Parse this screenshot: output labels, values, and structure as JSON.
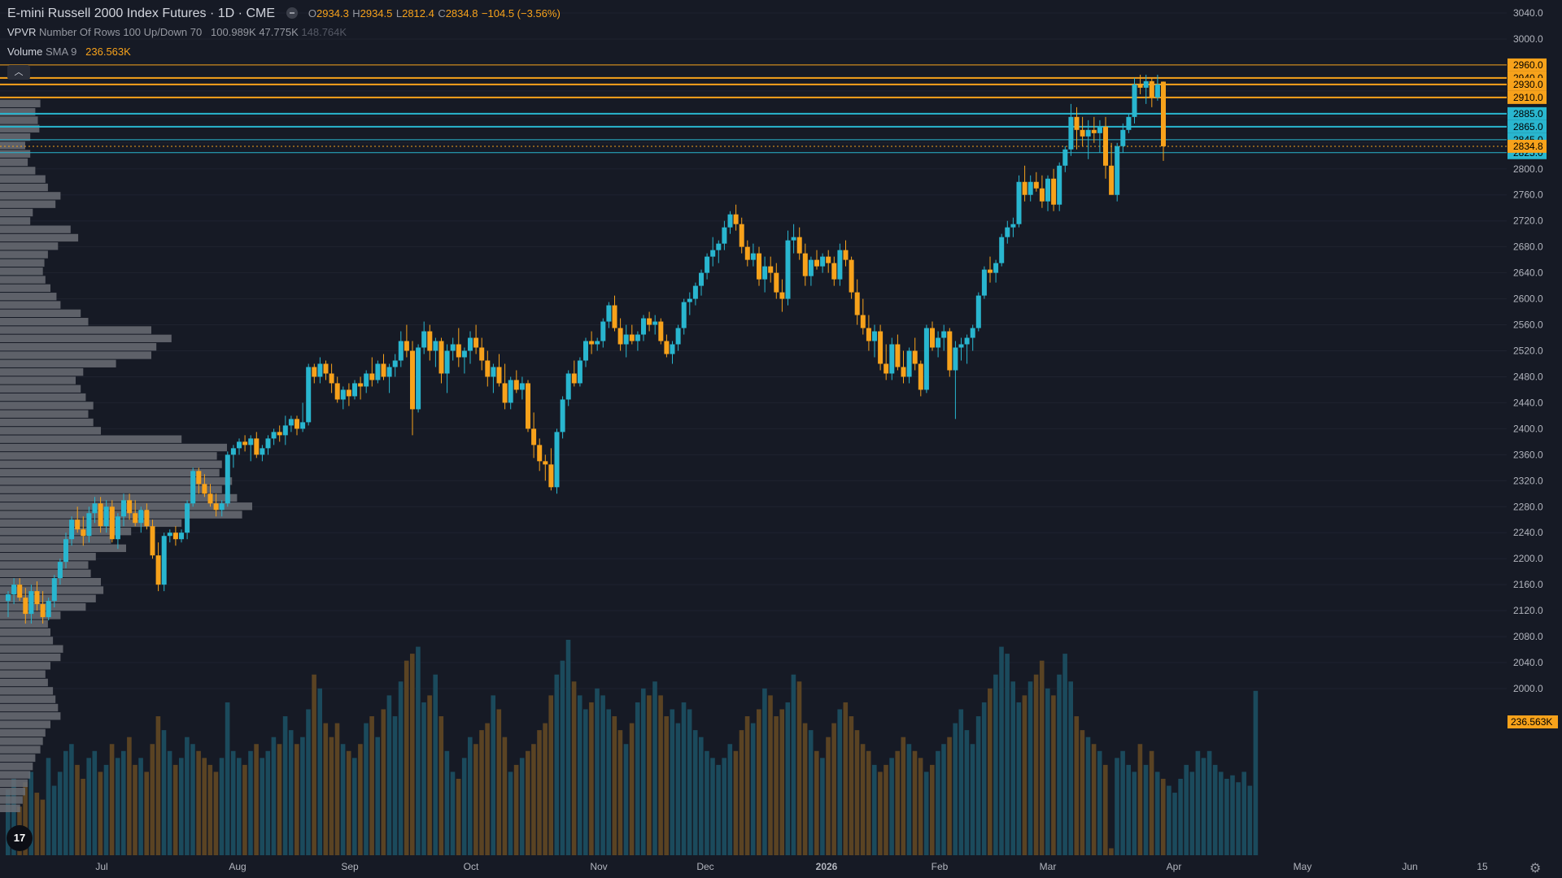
{
  "legend": {
    "symbol": "E-mini Russell 2000 Index Futures · 1D · CME",
    "open_label": "O",
    "open": "2934.3",
    "high_label": "H",
    "high": "2934.5",
    "low_label": "L",
    "low": "2812.4",
    "close_label": "C",
    "close": "2834.8",
    "change": "−104.5 (−3.56%)",
    "vpvr_name": "VPVR",
    "vpvr_params": "Number Of Rows 100 Up/Down 70",
    "vpvr_v1": "100.989K",
    "vpvr_v2": "47.775K",
    "vpvr_v3": "148.764K",
    "volume_name": "Volume",
    "volume_params": "SMA 9",
    "volume_value": "236.563K"
  },
  "colors": {
    "background": "#161a25",
    "up": "#29b6cf",
    "down": "#f7a21b",
    "volume_up": "#1b4a5c",
    "volume_down": "#5a4323",
    "profile": "#6b6e75",
    "grid": "#1f2330",
    "axis_text": "#b2b5be"
  },
  "price_axis": {
    "ticks": [
      "3040.0",
      "3000.0",
      "2800.0",
      "2760.0",
      "2720.0",
      "2680.0",
      "2640.0",
      "2600.0",
      "2560.0",
      "2520.0",
      "2480.0",
      "2440.0",
      "2400.0",
      "2360.0",
      "2320.0",
      "2280.0",
      "2240.0",
      "2200.0",
      "2160.0",
      "2120.0",
      "2080.0",
      "2040.0",
      "2000.0"
    ]
  },
  "level_labels": {
    "orange": [
      "2960.0",
      "2940.0",
      "2930.0",
      "2910.0"
    ],
    "blue": [
      "2885.0",
      "2865.0",
      "2845.0",
      "2825.0"
    ],
    "last_price": "2834.8",
    "volume_sma": "236.563K"
  },
  "time_axis": {
    "labels": [
      "Jul",
      "Aug",
      "Sep",
      "Oct",
      "Nov",
      "Dec",
      "2026",
      "Feb",
      "Mar",
      "Apr",
      "May",
      "Jun",
      "15"
    ]
  },
  "icons": {
    "tv_logo": "17",
    "gear": "⚙",
    "collapse": "︿"
  },
  "chart_data": {
    "type": "candlestick",
    "y_range": [
      1995,
      3050
    ],
    "horizontal_levels": {
      "orange": [
        2960.0,
        2940.0,
        2930.0,
        2910.0
      ],
      "blue": [
        2885.0,
        2865.0,
        2845.0,
        2825.0
      ],
      "last_price": 2834.8
    },
    "candles": [
      [
        2135,
        2150,
        2110,
        2145
      ],
      [
        2145,
        2170,
        2130,
        2160
      ],
      [
        2160,
        2170,
        2135,
        2140
      ],
      [
        2140,
        2155,
        2100,
        2115
      ],
      [
        2115,
        2160,
        2100,
        2150
      ],
      [
        2150,
        2165,
        2120,
        2130
      ],
      [
        2130,
        2150,
        2100,
        2110
      ],
      [
        2110,
        2140,
        2105,
        2135
      ],
      [
        2135,
        2175,
        2125,
        2170
      ],
      [
        2170,
        2200,
        2160,
        2195
      ],
      [
        2195,
        2240,
        2185,
        2230
      ],
      [
        2230,
        2265,
        2220,
        2260
      ],
      [
        2260,
        2280,
        2240,
        2245
      ],
      [
        2245,
        2265,
        2220,
        2235
      ],
      [
        2235,
        2280,
        2225,
        2270
      ],
      [
        2270,
        2295,
        2255,
        2285
      ],
      [
        2285,
        2295,
        2240,
        2250
      ],
      [
        2250,
        2290,
        2240,
        2280
      ],
      [
        2280,
        2290,
        2225,
        2230
      ],
      [
        2230,
        2270,
        2215,
        2265
      ],
      [
        2265,
        2300,
        2250,
        2290
      ],
      [
        2290,
        2300,
        2260,
        2270
      ],
      [
        2270,
        2290,
        2250,
        2255
      ],
      [
        2255,
        2280,
        2240,
        2275
      ],
      [
        2275,
        2285,
        2245,
        2250
      ],
      [
        2250,
        2260,
        2200,
        2205
      ],
      [
        2205,
        2225,
        2150,
        2160
      ],
      [
        2160,
        2240,
        2150,
        2235
      ],
      [
        2235,
        2245,
        2225,
        2240
      ],
      [
        2240,
        2250,
        2220,
        2230
      ],
      [
        2230,
        2245,
        2225,
        2240
      ],
      [
        2240,
        2290,
        2230,
        2285
      ],
      [
        2285,
        2340,
        2280,
        2335
      ],
      [
        2335,
        2340,
        2300,
        2315
      ],
      [
        2315,
        2330,
        2295,
        2300
      ],
      [
        2300,
        2315,
        2280,
        2285
      ],
      [
        2285,
        2300,
        2265,
        2275
      ],
      [
        2275,
        2290,
        2265,
        2285
      ],
      [
        2285,
        2365,
        2280,
        2360
      ],
      [
        2360,
        2375,
        2340,
        2370
      ],
      [
        2370,
        2385,
        2360,
        2380
      ],
      [
        2380,
        2390,
        2365,
        2375
      ],
      [
        2375,
        2390,
        2350,
        2385
      ],
      [
        2385,
        2395,
        2355,
        2360
      ],
      [
        2360,
        2375,
        2350,
        2370
      ],
      [
        2370,
        2390,
        2360,
        2385
      ],
      [
        2385,
        2400,
        2375,
        2395
      ],
      [
        2395,
        2405,
        2380,
        2390
      ],
      [
        2390,
        2420,
        2375,
        2405
      ],
      [
        2405,
        2420,
        2395,
        2415
      ],
      [
        2415,
        2420,
        2390,
        2400
      ],
      [
        2400,
        2440,
        2395,
        2410
      ],
      [
        2410,
        2500,
        2405,
        2495
      ],
      [
        2495,
        2500,
        2470,
        2480
      ],
      [
        2480,
        2510,
        2470,
        2500
      ],
      [
        2500,
        2505,
        2475,
        2485
      ],
      [
        2485,
        2500,
        2455,
        2470
      ],
      [
        2470,
        2480,
        2440,
        2445
      ],
      [
        2445,
        2465,
        2430,
        2460
      ],
      [
        2460,
        2470,
        2435,
        2450
      ],
      [
        2450,
        2475,
        2445,
        2470
      ],
      [
        2470,
        2480,
        2445,
        2465
      ],
      [
        2465,
        2490,
        2455,
        2485
      ],
      [
        2485,
        2510,
        2465,
        2475
      ],
      [
        2475,
        2505,
        2470,
        2500
      ],
      [
        2500,
        2515,
        2475,
        2480
      ],
      [
        2480,
        2500,
        2455,
        2495
      ],
      [
        2495,
        2515,
        2480,
        2505
      ],
      [
        2505,
        2550,
        2495,
        2535
      ],
      [
        2535,
        2560,
        2510,
        2520
      ],
      [
        2520,
        2535,
        2390,
        2430
      ],
      [
        2430,
        2530,
        2425,
        2525
      ],
      [
        2525,
        2565,
        2515,
        2550
      ],
      [
        2550,
        2560,
        2505,
        2520
      ],
      [
        2520,
        2540,
        2495,
        2535
      ],
      [
        2535,
        2540,
        2470,
        2485
      ],
      [
        2485,
        2530,
        2455,
        2520
      ],
      [
        2520,
        2540,
        2505,
        2530
      ],
      [
        2530,
        2555,
        2495,
        2510
      ],
      [
        2510,
        2525,
        2485,
        2520
      ],
      [
        2520,
        2550,
        2500,
        2540
      ],
      [
        2540,
        2560,
        2515,
        2525
      ],
      [
        2525,
        2540,
        2490,
        2505
      ],
      [
        2505,
        2520,
        2465,
        2480
      ],
      [
        2480,
        2500,
        2455,
        2495
      ],
      [
        2495,
        2515,
        2465,
        2470
      ],
      [
        2470,
        2500,
        2430,
        2440
      ],
      [
        2440,
        2480,
        2430,
        2475
      ],
      [
        2475,
        2490,
        2455,
        2460
      ],
      [
        2460,
        2480,
        2445,
        2470
      ],
      [
        2470,
        2475,
        2395,
        2400
      ],
      [
        2400,
        2425,
        2355,
        2375
      ],
      [
        2375,
        2385,
        2335,
        2350
      ],
      [
        2350,
        2360,
        2320,
        2345
      ],
      [
        2345,
        2370,
        2305,
        2310
      ],
      [
        2310,
        2400,
        2300,
        2395
      ],
      [
        2395,
        2450,
        2385,
        2445
      ],
      [
        2445,
        2490,
        2435,
        2485
      ],
      [
        2485,
        2505,
        2465,
        2470
      ],
      [
        2470,
        2510,
        2465,
        2505
      ],
      [
        2505,
        2540,
        2495,
        2535
      ],
      [
        2535,
        2550,
        2515,
        2530
      ],
      [
        2530,
        2540,
        2520,
        2535
      ],
      [
        2535,
        2570,
        2525,
        2565
      ],
      [
        2565,
        2595,
        2555,
        2590
      ],
      [
        2590,
        2605,
        2550,
        2555
      ],
      [
        2555,
        2570,
        2520,
        2530
      ],
      [
        2530,
        2560,
        2510,
        2545
      ],
      [
        2545,
        2560,
        2530,
        2535
      ],
      [
        2535,
        2550,
        2520,
        2545
      ],
      [
        2545,
        2575,
        2535,
        2570
      ],
      [
        2570,
        2580,
        2550,
        2560
      ],
      [
        2560,
        2575,
        2545,
        2565
      ],
      [
        2565,
        2570,
        2530,
        2535
      ],
      [
        2535,
        2545,
        2510,
        2515
      ],
      [
        2515,
        2535,
        2500,
        2530
      ],
      [
        2530,
        2560,
        2520,
        2555
      ],
      [
        2555,
        2600,
        2545,
        2595
      ],
      [
        2595,
        2610,
        2575,
        2600
      ],
      [
        2600,
        2625,
        2590,
        2620
      ],
      [
        2620,
        2645,
        2605,
        2640
      ],
      [
        2640,
        2670,
        2630,
        2665
      ],
      [
        2665,
        2695,
        2650,
        2675
      ],
      [
        2675,
        2690,
        2655,
        2685
      ],
      [
        2685,
        2720,
        2675,
        2710
      ],
      [
        2710,
        2735,
        2700,
        2730
      ],
      [
        2730,
        2745,
        2705,
        2715
      ],
      [
        2715,
        2725,
        2670,
        2680
      ],
      [
        2680,
        2690,
        2650,
        2660
      ],
      [
        2660,
        2685,
        2650,
        2670
      ],
      [
        2670,
        2680,
        2620,
        2630
      ],
      [
        2630,
        2665,
        2610,
        2650
      ],
      [
        2650,
        2665,
        2625,
        2640
      ],
      [
        2640,
        2655,
        2600,
        2610
      ],
      [
        2610,
        2630,
        2580,
        2600
      ],
      [
        2600,
        2705,
        2590,
        2690
      ],
      [
        2690,
        2715,
        2670,
        2695
      ],
      [
        2695,
        2710,
        2660,
        2670
      ],
      [
        2670,
        2685,
        2620,
        2635
      ],
      [
        2635,
        2665,
        2620,
        2660
      ],
      [
        2660,
        2675,
        2645,
        2650
      ],
      [
        2650,
        2670,
        2640,
        2665
      ],
      [
        2665,
        2675,
        2640,
        2655
      ],
      [
        2655,
        2665,
        2620,
        2630
      ],
      [
        2630,
        2685,
        2620,
        2675
      ],
      [
        2675,
        2690,
        2650,
        2660
      ],
      [
        2660,
        2665,
        2600,
        2610
      ],
      [
        2610,
        2630,
        2560,
        2575
      ],
      [
        2575,
        2600,
        2545,
        2555
      ],
      [
        2555,
        2575,
        2520,
        2535
      ],
      [
        2535,
        2560,
        2510,
        2550
      ],
      [
        2550,
        2560,
        2490,
        2500
      ],
      [
        2500,
        2530,
        2475,
        2485
      ],
      [
        2485,
        2540,
        2475,
        2530
      ],
      [
        2530,
        2545,
        2490,
        2495
      ],
      [
        2495,
        2520,
        2470,
        2480
      ],
      [
        2480,
        2525,
        2470,
        2520
      ],
      [
        2520,
        2540,
        2490,
        2500
      ],
      [
        2500,
        2505,
        2450,
        2460
      ],
      [
        2460,
        2560,
        2455,
        2555
      ],
      [
        2555,
        2565,
        2520,
        2525
      ],
      [
        2525,
        2550,
        2510,
        2540
      ],
      [
        2540,
        2560,
        2520,
        2550
      ],
      [
        2550,
        2555,
        2480,
        2490
      ],
      [
        2490,
        2535,
        2415,
        2525
      ],
      [
        2525,
        2540,
        2505,
        2530
      ],
      [
        2530,
        2545,
        2500,
        2540
      ],
      [
        2540,
        2560,
        2520,
        2555
      ],
      [
        2555,
        2610,
        2550,
        2605
      ],
      [
        2605,
        2650,
        2600,
        2645
      ],
      [
        2645,
        2665,
        2625,
        2640
      ],
      [
        2640,
        2660,
        2625,
        2655
      ],
      [
        2655,
        2700,
        2650,
        2695
      ],
      [
        2695,
        2720,
        2685,
        2710
      ],
      [
        2710,
        2725,
        2695,
        2715
      ],
      [
        2715,
        2790,
        2710,
        2780
      ],
      [
        2780,
        2805,
        2750,
        2760
      ],
      [
        2760,
        2790,
        2750,
        2780
      ],
      [
        2780,
        2795,
        2765,
        2770
      ],
      [
        2770,
        2790,
        2740,
        2750
      ],
      [
        2750,
        2790,
        2735,
        2785
      ],
      [
        2785,
        2800,
        2735,
        2745
      ],
      [
        2745,
        2810,
        2735,
        2805
      ],
      [
        2805,
        2835,
        2795,
        2830
      ],
      [
        2830,
        2900,
        2820,
        2880
      ],
      [
        2880,
        2895,
        2830,
        2860
      ],
      [
        2860,
        2880,
        2835,
        2850
      ],
      [
        2850,
        2875,
        2815,
        2860
      ],
      [
        2860,
        2880,
        2840,
        2855
      ],
      [
        2855,
        2875,
        2825,
        2865
      ],
      [
        2865,
        2880,
        2785,
        2805
      ],
      [
        2805,
        2840,
        2770,
        2760
      ],
      [
        2760,
        2840,
        2750,
        2835
      ],
      [
        2835,
        2870,
        2825,
        2860
      ],
      [
        2860,
        2885,
        2855,
        2880
      ],
      [
        2880,
        2940,
        2870,
        2930
      ],
      [
        2930,
        2945,
        2915,
        2925
      ],
      [
        2925,
        2945,
        2900,
        2935
      ],
      [
        2935,
        2940,
        2895,
        2910
      ],
      [
        2910,
        2945,
        2905,
        2930
      ],
      [
        2934.3,
        2934.5,
        2812.4,
        2834.8
      ]
    ],
    "volume": [
      95,
      110,
      70,
      105,
      120,
      90,
      80,
      140,
      100,
      120,
      150,
      160,
      130,
      110,
      140,
      150,
      120,
      130,
      160,
      140,
      150,
      170,
      130,
      140,
      120,
      160,
      200,
      180,
      150,
      130,
      140,
      170,
      160,
      150,
      140,
      130,
      120,
      140,
      220,
      150,
      140,
      130,
      150,
      160,
      140,
      150,
      170,
      160,
      200,
      180,
      160,
      170,
      210,
      260,
      240,
      190,
      170,
      190,
      160,
      150,
      140,
      160,
      190,
      200,
      170,
      210,
      230,
      200,
      250,
      280,
      290,
      300,
      220,
      230,
      260,
      200,
      150,
      120,
      110,
      140,
      170,
      160,
      180,
      190,
      230,
      210,
      170,
      120,
      130,
      140,
      150,
      160,
      180,
      190,
      230,
      260,
      280,
      310,
      250,
      230,
      210,
      220,
      240,
      230,
      210,
      200,
      180,
      160,
      190,
      220,
      240,
      230,
      250,
      230,
      200,
      210,
      190,
      220,
      210,
      180,
      170,
      150,
      140,
      130,
      140,
      160,
      150,
      180,
      200,
      190,
      210,
      240,
      230,
      200,
      210,
      220,
      260,
      250,
      190,
      180,
      150,
      140,
      170,
      190,
      210,
      220,
      200,
      180,
      160,
      150,
      130,
      120,
      130,
      140,
      150,
      170,
      160,
      150,
      140,
      120,
      130,
      150,
      160,
      170,
      190,
      210,
      180,
      160,
      200,
      220,
      240,
      260,
      300,
      290,
      250,
      220,
      230,
      250,
      260,
      280,
      240,
      230,
      260,
      290,
      250,
      200,
      180,
      170,
      160,
      150,
      130,
      10,
      140,
      150,
      130,
      120,
      160,
      130,
      150,
      120,
      110,
      100,
      90,
      110,
      130,
      120,
      150,
      140,
      150,
      130,
      120,
      110,
      115,
      105,
      120,
      100,
      236.563
    ]
  }
}
